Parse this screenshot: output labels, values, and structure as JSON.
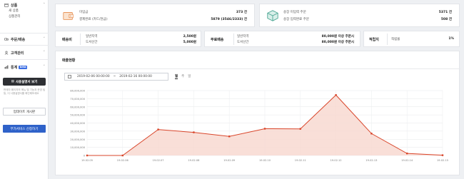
{
  "sidebar": {
    "products": {
      "label": "상품",
      "items": [
        "새 상품",
        "상품관리"
      ]
    },
    "orders": {
      "label": "주문/배송"
    },
    "customers": {
      "label": "고객관리"
    },
    "stats": {
      "label": "통계",
      "badge": "beta"
    },
    "manual_button": "사용설명서 보기",
    "manual_note": "판매자 페이지의 매뉴 및 기능과 운영 팁 등, 더 사용설명서를 확인해보세요",
    "update_button": "업데이트 게시판",
    "addon_button": "부가서비스 신청하기"
  },
  "summary": {
    "left": {
      "label1": "미입금",
      "value1": "373 건",
      "label2": "결제완료 (카드/현금)",
      "value2": "5879 (3546/2333) 건"
    },
    "right": {
      "label1": "송장 미입력 주문",
      "value1": "5371 건",
      "label2": "송장 입력완료 주문",
      "value2": "508 건"
    }
  },
  "shipping": {
    "fee": {
      "title": "배송비",
      "row1_label": "일반지역",
      "row1_value": "2,500원",
      "row2_label": "도서산간",
      "row2_value": "5,000원"
    },
    "free": {
      "title": "무료배송",
      "row1_label": "일반지역",
      "row1_value": "80,000원 이상 주문시",
      "row2_label": "도서산간",
      "row2_value": "80,000원 이상 주문시"
    },
    "reserve": {
      "title": "적립지",
      "row1_label": "적립율",
      "row1_value": "1%"
    }
  },
  "sales": {
    "title": "매출현황",
    "date_start": "2019-02-06 00:00:00",
    "date_sep": "~",
    "date_end": "2019-02-16 00:00:00",
    "tabs": [
      "월",
      "주",
      "일"
    ],
    "active_tab": "월"
  },
  "chart_data": {
    "type": "area",
    "x": [
      "19.02.05",
      "19.02.06",
      "19.02.07",
      "19.02.08",
      "19.02.09",
      "19.02.10",
      "19.02.11",
      "19.02.12",
      "19.02.13",
      "19.02.14",
      "19.02.15"
    ],
    "series": [
      {
        "values": [
          0,
          0,
          32000000,
          28500000,
          23500000,
          33000000,
          32800000,
          74500000,
          27000000,
          2500000,
          300000
        ]
      }
    ],
    "ytick_labels": [
      "0",
      "10,000,000",
      "20,000,000",
      "30,000,000",
      "40,000,000",
      "50,000,000",
      "60,000,000",
      "70,000,000",
      "80,000,000"
    ],
    "ylim": [
      0,
      80000000
    ],
    "line_color": "#d9462b",
    "fill_color": "#f8d9d1",
    "grid": true
  },
  "colors": {
    "accent": "#2f62c9",
    "dark_button": "#2d2f33"
  }
}
